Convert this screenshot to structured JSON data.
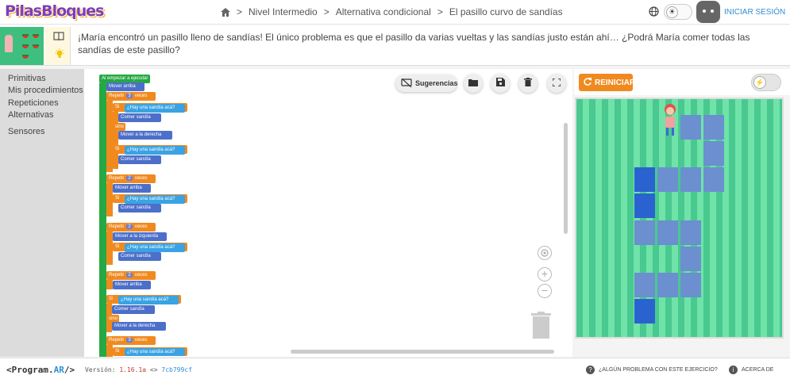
{
  "header": {
    "logo": "PilasBloques",
    "breadcrumbs": [
      "Nivel Intermedio",
      "Alternativa condicional",
      "El pasillo curvo de sandías"
    ],
    "separator": ">",
    "login_label": "INICIAR SESIÓN"
  },
  "description": {
    "text": "¡María encontró un pasillo lleno de sandías! El único problema es que el pasillo da varias vueltas y las sandías justo están ahí… ¿Podrá María comer todas las sandías de este pasillo?"
  },
  "categories": [
    "Primitivas",
    "Mis procedimientos",
    "Repeticiones",
    "Alternativas",
    "Sensores"
  ],
  "toolbar": {
    "suggestions_label": "Sugerencias"
  },
  "blocks": {
    "start": "Al empezar a ejecutar",
    "move_up": "Mover arriba",
    "repeat": "Repetir",
    "times": "veces",
    "if": "Si",
    "else": "sino",
    "has_watermelon": "¿Hay una sandía acá?",
    "eat": "Comer sandía",
    "move_right": "Mover a la derecha",
    "move_left": "Mover a la izquierda",
    "n3": "3",
    "n2": "2"
  },
  "stage": {
    "restart_label": "REINICIAR",
    "colors": {
      "grass_dark": "#49c98f",
      "grass_light": "#6fe3a8",
      "cell": "#6b8fcf",
      "cell_dark": "#2a63d0"
    }
  },
  "footer": {
    "brand_prefix": "<Program.",
    "brand_ar": "AR",
    "brand_suffix": "/>",
    "version_label": "Versión:",
    "version_number": "1.16.1a",
    "code_icon": "<>",
    "commit": "7cb799cf",
    "help_label": "¿ALGÚN PROBLEMA CON ESTE EJERCICIO?",
    "about_label": "ACERCA DE"
  }
}
